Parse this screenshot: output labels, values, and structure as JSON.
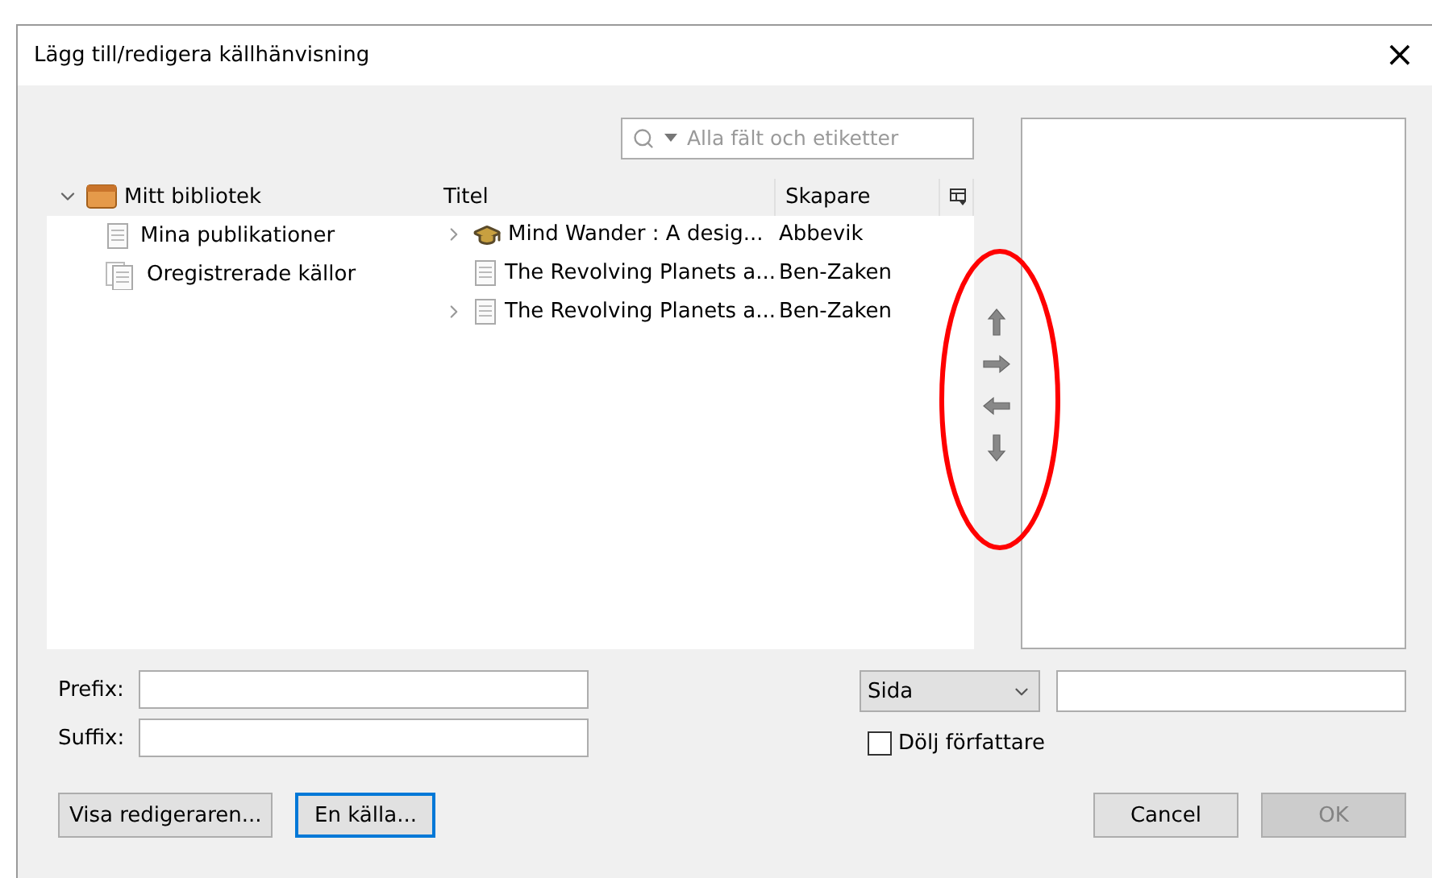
{
  "window": {
    "title": "Lägg till/redigera källhänvisning",
    "close": "×"
  },
  "search": {
    "placeholder": "Alla fält och etiketter"
  },
  "tree": [
    {
      "label": "Mitt bibliotek",
      "kind": "library",
      "expanded": true,
      "children": [
        {
          "label": "Mina publikationer",
          "kind": "document"
        },
        {
          "label": "Oregistrerade källor",
          "kind": "copies"
        }
      ]
    }
  ],
  "table": {
    "columns": [
      "Titel",
      "Skapare"
    ],
    "rows": [
      {
        "title": "Mind Wander : A desig...",
        "creator": "Abbevik",
        "kind": "thesis",
        "expandable": true
      },
      {
        "title": "The Revolving Planets a...",
        "creator": "Ben-Zaken",
        "kind": "document",
        "expandable": false
      },
      {
        "title": "The Revolving Planets a...",
        "creator": "Ben-Zaken",
        "kind": "document",
        "expandable": true
      }
    ]
  },
  "annotation": {
    "kind": "ellipse",
    "color": "#ff0000"
  },
  "prefix": {
    "label": "Prefix:"
  },
  "suffix": {
    "label": "Suffix:"
  },
  "locator": {
    "value": "Sida"
  },
  "hide_author": {
    "label": "Dölj författare",
    "checked": false
  },
  "buttons": [
    {
      "label": "Visa redigeraren...",
      "default": false,
      "disabled": false
    },
    {
      "label": "En källa...",
      "default": true,
      "disabled": false
    },
    {
      "label": "Cancel",
      "default": false,
      "disabled": false
    },
    {
      "label": "OK",
      "default": false,
      "disabled": true
    }
  ]
}
